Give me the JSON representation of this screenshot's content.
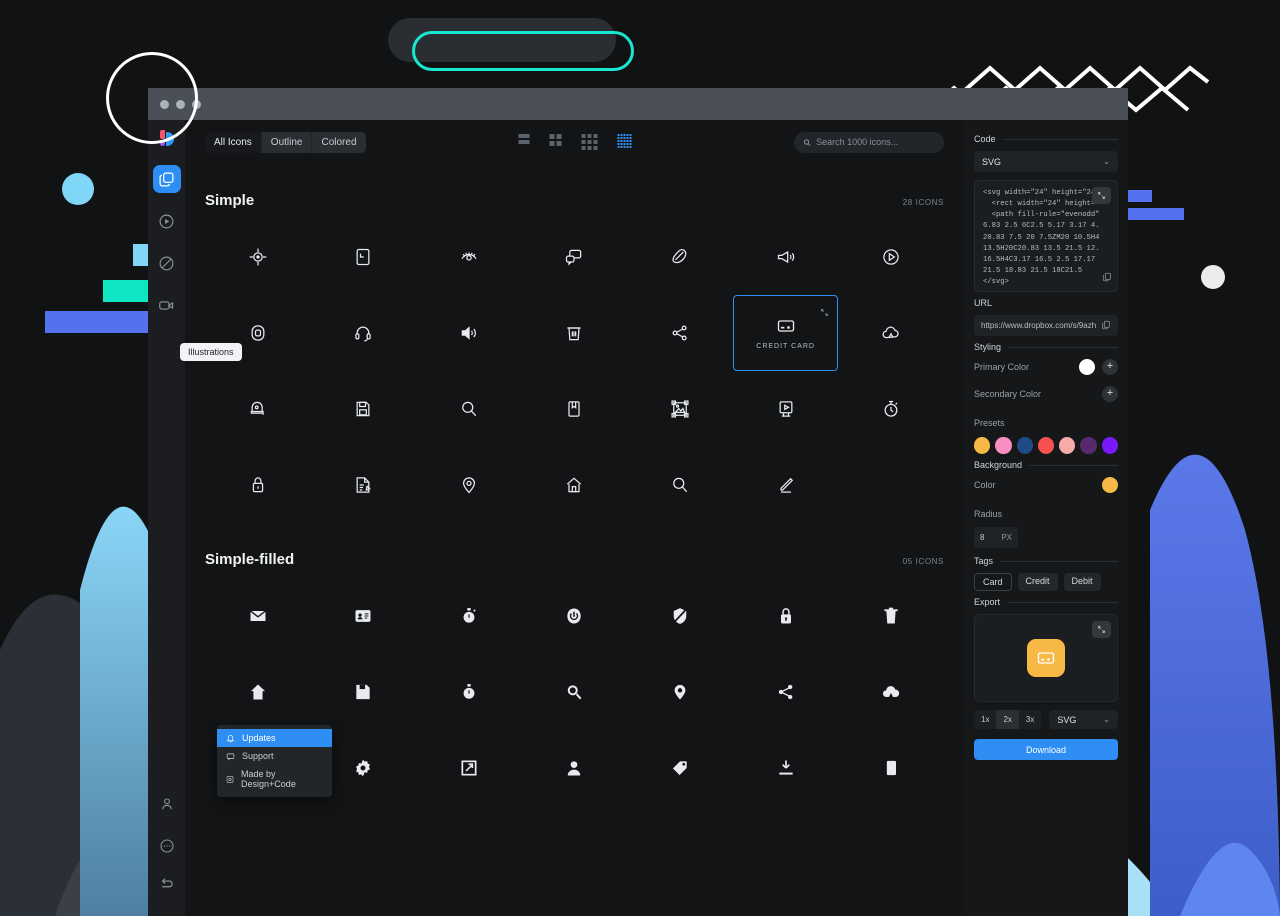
{
  "window": {
    "titlebar_dots": 3
  },
  "rail": {
    "logo": "designcode-logo",
    "items": [
      {
        "name": "illustrations",
        "icon": "layers-icon",
        "active": true
      },
      {
        "name": "animations",
        "icon": "play-circle-icon",
        "active": false
      },
      {
        "name": "compass",
        "icon": "compass-icon",
        "active": false
      },
      {
        "name": "videos",
        "icon": "video-camera-icon",
        "active": false
      }
    ],
    "bottom_items": [
      {
        "name": "account",
        "icon": "person-icon"
      },
      {
        "name": "more",
        "icon": "ellipsis-circle-icon"
      },
      {
        "name": "back",
        "icon": "return-arrow-icon"
      }
    ],
    "tooltip": "Illustrations"
  },
  "toolbar": {
    "filters": [
      {
        "label": "All Icons",
        "active": true
      },
      {
        "label": "Outline",
        "active": false
      },
      {
        "label": "Colored",
        "active": false
      }
    ],
    "views": [
      {
        "name": "list-view",
        "cols": 1,
        "rows": 2,
        "active": false
      },
      {
        "name": "large-grid-view",
        "cols": 2,
        "rows": 2,
        "active": false
      },
      {
        "name": "medium-grid-view",
        "cols": 3,
        "rows": 3,
        "active": false
      },
      {
        "name": "small-grid-view",
        "cols": 5,
        "rows": 5,
        "active": true
      }
    ]
  },
  "search": {
    "placeholder": "Search 1000 icons...",
    "value": ""
  },
  "sections": [
    {
      "title": "Simple",
      "count": "28 ICONS",
      "icons": [
        {
          "name": "target-icon",
          "glyph": "◎",
          "label": "",
          "selected": false
        },
        {
          "name": "calendar-icon",
          "glyph": "▣",
          "label": "",
          "selected": false
        },
        {
          "name": "eye-icon",
          "glyph": "◉",
          "label": "",
          "selected": false
        },
        {
          "name": "chat-bubbles-icon",
          "glyph": "💬",
          "label": "",
          "selected": false
        },
        {
          "name": "feather-icon",
          "glyph": "✒",
          "label": "",
          "selected": false
        },
        {
          "name": "megaphone-icon",
          "glyph": "📣",
          "label": "",
          "selected": false
        },
        {
          "name": "play-circle-icon",
          "glyph": "▷",
          "label": "",
          "selected": false
        },
        {
          "name": "record-icon",
          "glyph": "◉",
          "label": "",
          "selected": false
        },
        {
          "name": "headset-icon",
          "glyph": "🎧",
          "label": "",
          "selected": false
        },
        {
          "name": "volume-icon",
          "glyph": "🔊",
          "label": "",
          "selected": false
        },
        {
          "name": "trash-icon",
          "glyph": "🗑",
          "label": "",
          "selected": false
        },
        {
          "name": "share-icon",
          "glyph": "⤳",
          "label": "",
          "selected": false
        },
        {
          "name": "credit-card-icon",
          "glyph": "▭",
          "label": "CREDIT CARD",
          "selected": true
        },
        {
          "name": "cloud-icon",
          "glyph": "☁",
          "label": "",
          "selected": false
        },
        {
          "name": "alarm-bell-icon",
          "glyph": "🔔",
          "label": "",
          "selected": false
        },
        {
          "name": "save-icon",
          "glyph": "💾",
          "label": "",
          "selected": false
        },
        {
          "name": "search-icon",
          "glyph": "🔍",
          "label": "",
          "selected": false
        },
        {
          "name": "bookmark-icon",
          "glyph": "🔖",
          "label": "",
          "selected": false
        },
        {
          "name": "image-frame-icon",
          "glyph": "🖼",
          "label": "",
          "selected": false
        },
        {
          "name": "video-player-icon",
          "glyph": "▶",
          "label": "",
          "selected": false
        },
        {
          "name": "stopwatch-icon",
          "glyph": "⏱",
          "label": "",
          "selected": false
        },
        {
          "name": "lock-icon",
          "glyph": "🔒",
          "label": "",
          "selected": false
        },
        {
          "name": "note-edit-icon",
          "glyph": "📝",
          "label": "",
          "selected": false
        },
        {
          "name": "map-pin-icon",
          "glyph": "📍",
          "label": "",
          "selected": false
        },
        {
          "name": "home-icon",
          "glyph": "🏠",
          "label": "",
          "selected": false
        },
        {
          "name": "zoom-icon",
          "glyph": "🔍",
          "label": "",
          "selected": false
        },
        {
          "name": "pen-icon",
          "glyph": "✎",
          "label": "",
          "selected": false
        }
      ]
    },
    {
      "title": "Simple-filled",
      "count": "05 ICONS",
      "icons": [
        {
          "name": "mail-filled-icon",
          "glyph": "✉",
          "label": "",
          "selected": false
        },
        {
          "name": "id-card-filled-icon",
          "glyph": "🪪",
          "label": "",
          "selected": false
        },
        {
          "name": "stopwatch-filled-icon",
          "glyph": "⏱",
          "label": "",
          "selected": false
        },
        {
          "name": "power-filled-icon",
          "glyph": "⏻",
          "label": "",
          "selected": false
        },
        {
          "name": "shield-filled-icon",
          "glyph": "🛡",
          "label": "",
          "selected": false
        },
        {
          "name": "lock-filled-icon",
          "glyph": "🔒",
          "label": "",
          "selected": false
        },
        {
          "name": "trash-filled-icon",
          "glyph": "🗑",
          "label": "",
          "selected": false
        },
        {
          "name": "home-filled-icon",
          "glyph": "🏠",
          "label": "",
          "selected": false
        },
        {
          "name": "save-filled-icon",
          "glyph": "💾",
          "label": "",
          "selected": false
        },
        {
          "name": "timer-filled-icon",
          "glyph": "⏱",
          "label": "",
          "selected": false
        },
        {
          "name": "search-filled-icon",
          "glyph": "🔍",
          "label": "",
          "selected": false
        },
        {
          "name": "location-filled-icon",
          "glyph": "◉",
          "label": "",
          "selected": false
        },
        {
          "name": "share-filled-icon",
          "glyph": "⤳",
          "label": "",
          "selected": false
        },
        {
          "name": "cloud-filled-icon",
          "glyph": "☁",
          "label": "",
          "selected": false
        },
        {
          "name": "pen-filled-icon",
          "glyph": "✎",
          "label": "",
          "selected": false
        },
        {
          "name": "settings-filled-icon",
          "glyph": "⚙",
          "label": "",
          "selected": false
        },
        {
          "name": "edit-square-filled-icon",
          "glyph": "⊡",
          "label": "",
          "selected": false
        },
        {
          "name": "person-filled-icon",
          "glyph": "👤",
          "label": "",
          "selected": false
        },
        {
          "name": "tag-filled-icon",
          "glyph": "🏷",
          "label": "",
          "selected": false
        },
        {
          "name": "download-filled-icon",
          "glyph": "⤓",
          "label": "",
          "selected": false
        },
        {
          "name": "copy-filled-icon",
          "glyph": "⧉",
          "label": "",
          "selected": false
        }
      ]
    }
  ],
  "context_menu": {
    "items": [
      {
        "label": "Updates",
        "icon": "bell-icon",
        "highlight": true
      },
      {
        "label": "Support",
        "icon": "chat-icon",
        "highlight": false
      },
      {
        "label": "Made by Design+Code",
        "icon": "designcode-icon",
        "highlight": false
      }
    ]
  },
  "inspector": {
    "code": {
      "group": "Code",
      "format": "SVG",
      "snippet": "<svg width=\"24\" height=\"24\"\n  <rect width=\"24\" height=\"\n  <path fill-rule=\"evenodd\"\n6.83 2.5 6C2.5 5.17 3.17 4.\n20.83 7.5 20 7.5ZM20 10.5H4\n13.5H20C20.83 13.5 21.5 12.\n16.5H4C3.17 16.5 2.5 17.17\n21.5 18.83 21.5 18C21.5\n</svg>"
    },
    "url": {
      "group": "URL",
      "value": "https://www.dropbox.com/s/9azh"
    },
    "styling": {
      "group": "Styling",
      "primary_color_label": "Primary Color",
      "primary_color": "#ffffff",
      "secondary_color_label": "Secondary Color",
      "presets_label": "Presets",
      "presets": [
        "#f7b845",
        "#f78fc0",
        "#1f4b86",
        "#f8504f",
        "#f8a9a9",
        "#57296e",
        "#7a19f7"
      ]
    },
    "background": {
      "group": "Background",
      "color_label": "Color",
      "color": "#f7b845",
      "radius_label": "Radius",
      "radius_value": "8",
      "radius_unit": "PX"
    },
    "tags": {
      "group": "Tags",
      "items": [
        {
          "label": "Card",
          "outlined": true
        },
        {
          "label": "Credit",
          "outlined": false
        },
        {
          "label": "Debit",
          "outlined": false
        }
      ]
    },
    "export": {
      "group": "Export",
      "preview_icon": "credit-card-icon",
      "preview_bg": "#f7b845",
      "scales": [
        {
          "label": "1x",
          "active": false
        },
        {
          "label": "2x",
          "active": true
        },
        {
          "label": "3x",
          "active": false
        }
      ],
      "format": "SVG",
      "download_label": "Download"
    }
  }
}
